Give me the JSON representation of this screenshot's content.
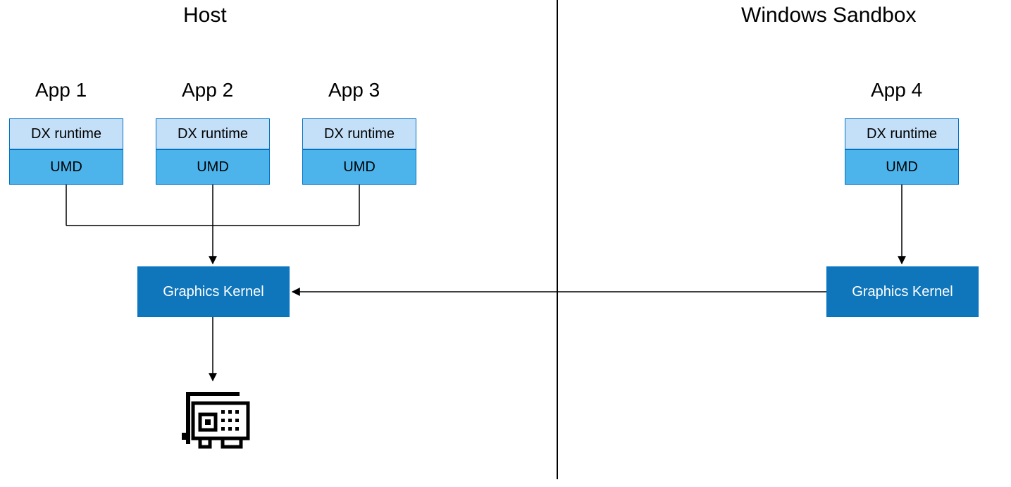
{
  "sections": {
    "host": "Host",
    "sandbox": "Windows Sandbox"
  },
  "apps": {
    "app1": "App 1",
    "app2": "App 2",
    "app3": "App 3",
    "app4": "App 4"
  },
  "layers": {
    "dx": "DX runtime",
    "umd": "UMD",
    "kernel": "Graphics Kernel"
  },
  "colors": {
    "border": "#0072c6",
    "dx_fill": "#c4e0f8",
    "umd_fill": "#4cb4eb",
    "kernel_fill": "#1076bc"
  }
}
